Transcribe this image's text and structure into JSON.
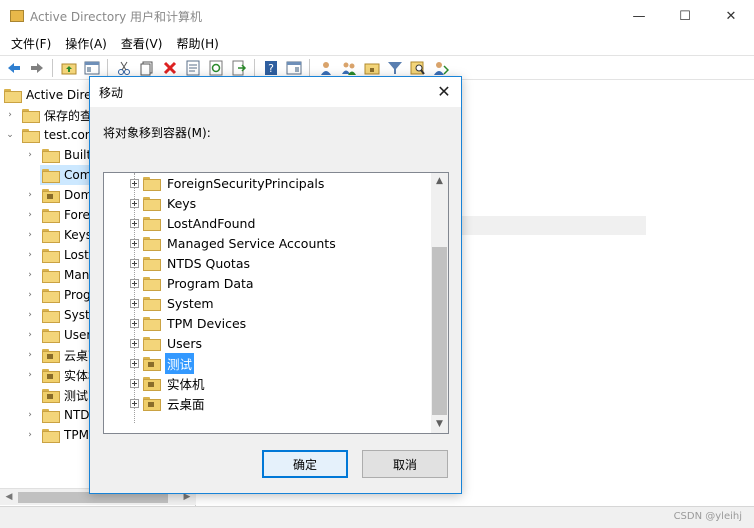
{
  "window": {
    "title": "Active Directory 用户和计算机",
    "minimize": "—",
    "maximize": "☐",
    "close": "✕"
  },
  "menu": [
    "文件(F)",
    "操作(A)",
    "查看(V)",
    "帮助(H)"
  ],
  "toolbar_icons": [
    "back-icon",
    "forward-icon",
    "up-folder-icon",
    "show-tree-icon",
    "cut-icon",
    "copy-icon",
    "delete-icon",
    "properties-icon",
    "refresh-icon",
    "export-icon",
    "help-icon",
    "console-icon",
    "new-user-icon",
    "new-group-icon",
    "new-ou-icon",
    "filter-icon",
    "find-icon",
    "delegate-icon"
  ],
  "tree": {
    "items": [
      {
        "label": "Active Directo",
        "type": "root"
      },
      {
        "label": "保存的查",
        "type": "folder"
      },
      {
        "label": "test.com",
        "type": "domain"
      },
      {
        "label": "Builtin",
        "type": "folder"
      },
      {
        "label": "Computers",
        "type": "folder",
        "selected": true
      },
      {
        "label": "Domain Controllers",
        "type": "ou"
      },
      {
        "label": "ForeignSecurityPrincipals",
        "type": "folder"
      },
      {
        "label": "Keys",
        "type": "folder"
      },
      {
        "label": "LostAndFound",
        "type": "folder"
      },
      {
        "label": "Managed Service Accounts",
        "type": "folder"
      },
      {
        "label": "Program Data",
        "type": "folder"
      },
      {
        "label": "System",
        "type": "folder"
      },
      {
        "label": "Users",
        "type": "folder"
      },
      {
        "label": "云桌面",
        "type": "ou"
      },
      {
        "label": "实体机",
        "type": "ou"
      },
      {
        "label": "测试",
        "type": "ou"
      },
      {
        "label": "NTDS Quotas",
        "type": "folder"
      },
      {
        "label": "TPM Devices",
        "type": "folder"
      }
    ]
  },
  "dialog": {
    "title": "移动",
    "prompt": "将对象移到容器(M):",
    "close": "✕",
    "containers": [
      {
        "label": "ForeignSecurityPrincipals",
        "type": "folder"
      },
      {
        "label": "Keys",
        "type": "folder"
      },
      {
        "label": "LostAndFound",
        "type": "folder"
      },
      {
        "label": "Managed Service Accounts",
        "type": "folder"
      },
      {
        "label": "NTDS Quotas",
        "type": "folder"
      },
      {
        "label": "Program Data",
        "type": "folder"
      },
      {
        "label": "System",
        "type": "folder"
      },
      {
        "label": "TPM Devices",
        "type": "folder"
      },
      {
        "label": "Users",
        "type": "folder"
      },
      {
        "label": "测试",
        "type": "ou",
        "selected": true
      },
      {
        "label": "实体机",
        "type": "ou"
      },
      {
        "label": "云桌面",
        "type": "ou"
      }
    ],
    "ok": "确定",
    "cancel": "取消",
    "scroll_up": "▲",
    "scroll_down": "▼"
  },
  "watermark": "CSDN @yleihj",
  "colors": {
    "accent": "#0078d7",
    "selection": "#3399ff",
    "folder": "#f3d57a"
  }
}
